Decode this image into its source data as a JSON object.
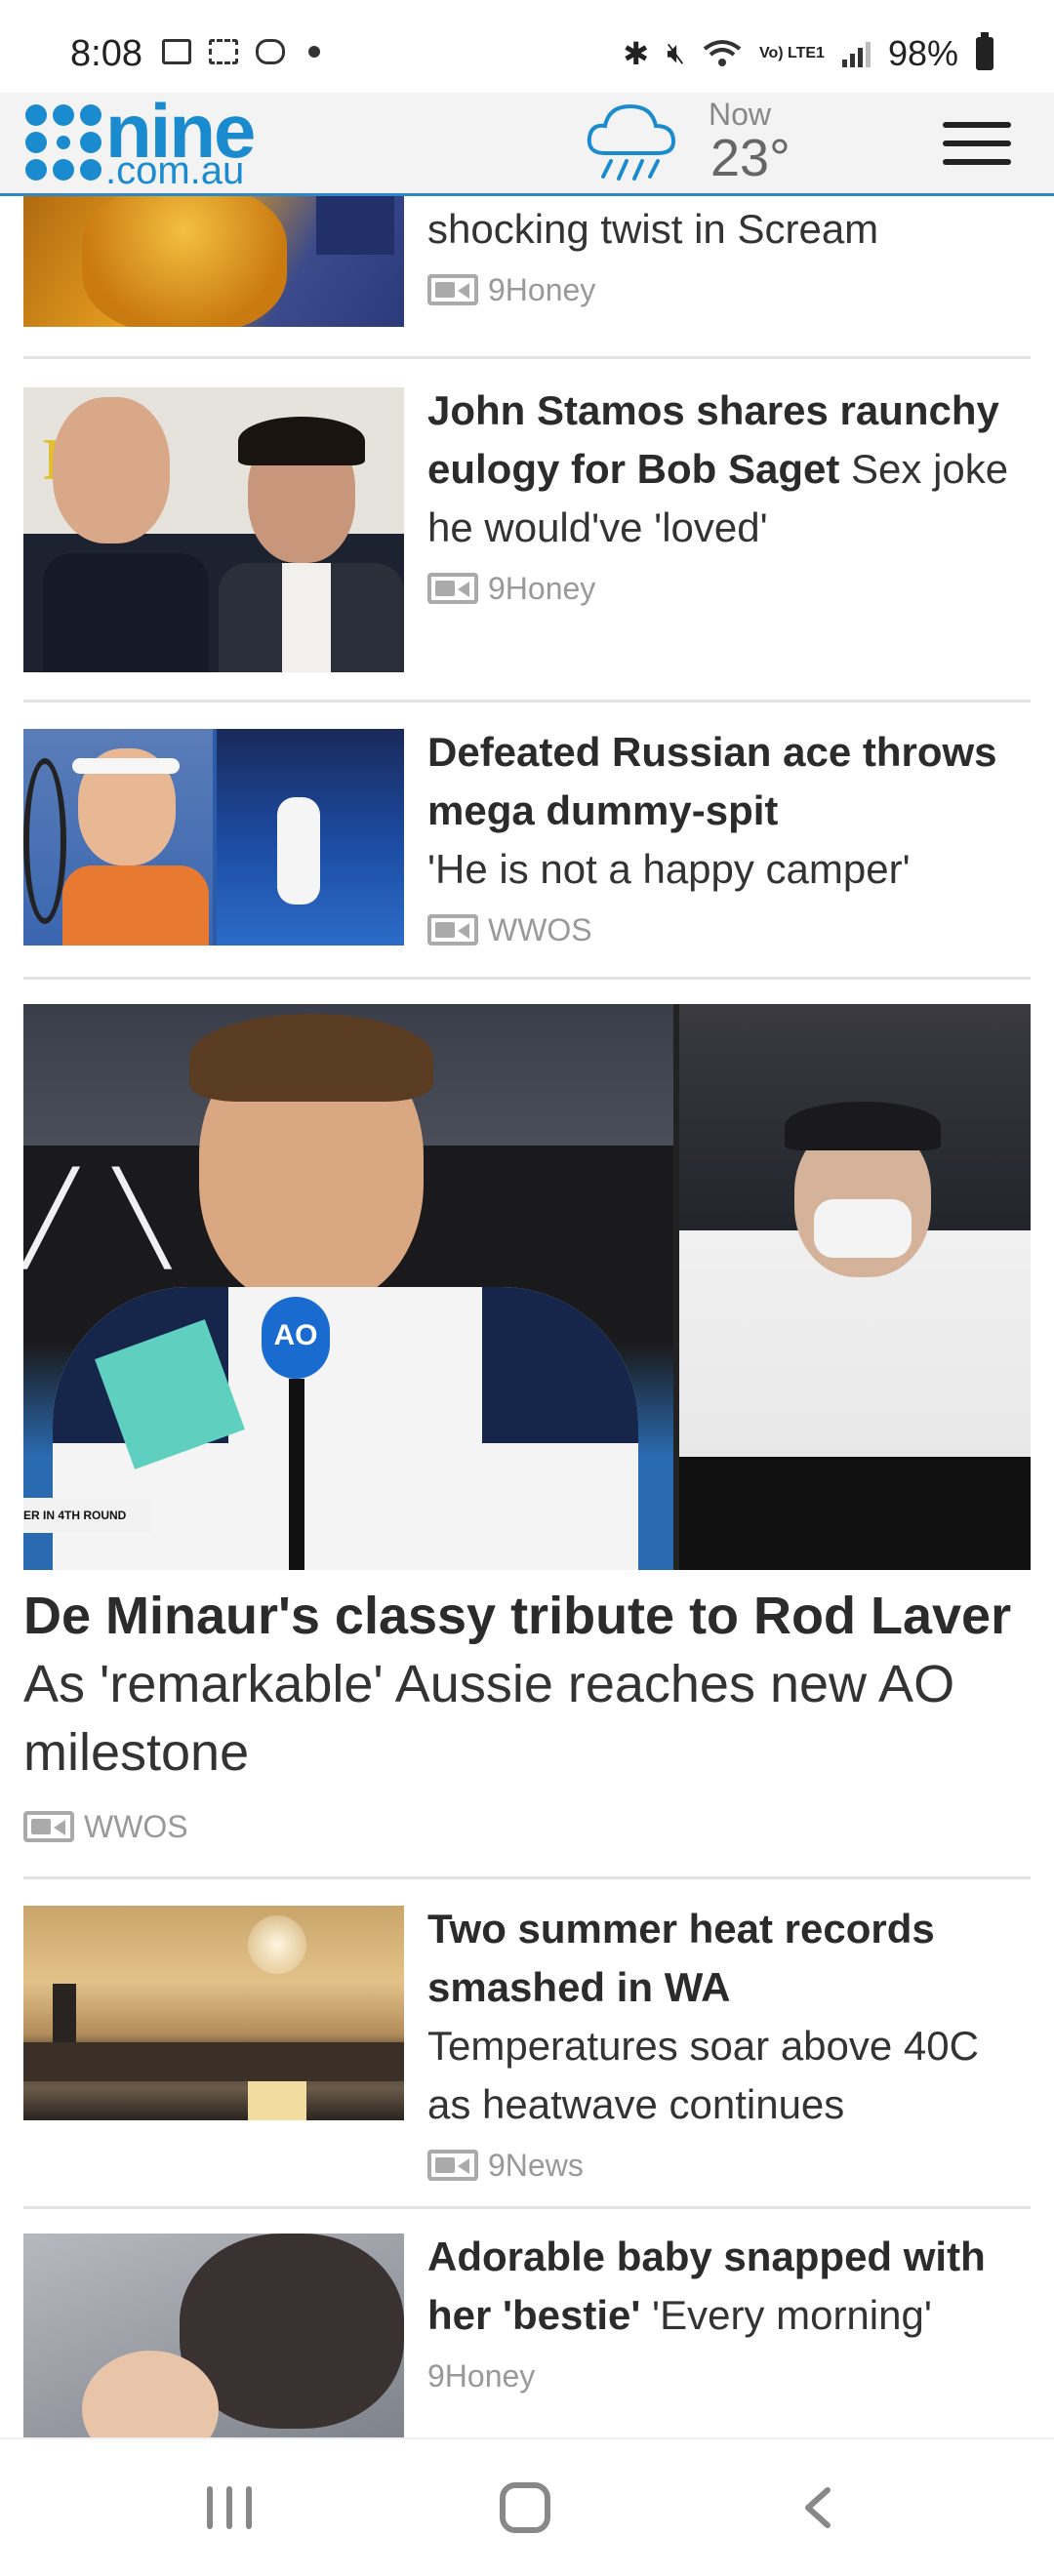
{
  "status_bar": {
    "time": "8:08",
    "battery": "98%",
    "network": "Vo) LTE1"
  },
  "header": {
    "logo_main": "nine",
    "logo_sub": ".com.au",
    "weather_label": "Now",
    "weather_temp": "23°",
    "icons": [
      "rain-cloud-icon",
      "hamburger-menu-icon"
    ]
  },
  "articles": [
    {
      "headline": "",
      "subtext": "shocking twist in Scream",
      "source": "9Honey"
    },
    {
      "headline": "John Stamos shares raunchy eulogy for Bob Saget",
      "subtext": " Sex joke he would've 'loved'",
      "source": "9Honey"
    },
    {
      "headline": "Defeated Russian ace throws mega dummy-spit",
      "subtext": "'He is not a happy camper'",
      "source": "WWOS"
    },
    {
      "headline": "De Minaur's classy tribute to Rod Laver",
      "subtext": " As 'remarkable' Aussie reaches new AO milestone",
      "source": "WWOS",
      "image_text": {
        "mic": "AO",
        "scoreboard": "ER IN 4TH ROUND"
      }
    },
    {
      "headline": "Two summer heat records smashed in WA",
      "subtext": "Temperatures soar above 40C as heatwave continues",
      "source": "9News"
    },
    {
      "headline": "Adorable baby snapped with her 'bestie'",
      "subtext": " 'Every morning'",
      "source": "9Honey"
    }
  ],
  "colors": {
    "brand_blue": "#1b8bd0",
    "header_border": "#2f86c4",
    "source_grey": "#999999"
  }
}
